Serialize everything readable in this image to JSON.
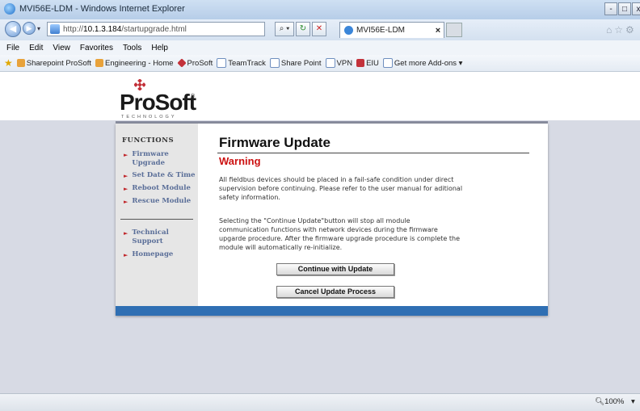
{
  "window": {
    "title": "MVI56E-LDM - Windows Internet Explorer",
    "buttons": [
      "-",
      "□",
      "x"
    ]
  },
  "address_bar": {
    "url_prefix": "http://",
    "url_host": "10.1.3.184",
    "url_path": "/startupgrade.html",
    "search_button": "⌕ ▾",
    "refresh_button": "↻",
    "stop_button": "✕"
  },
  "tab": {
    "title": "MVI56E-LDM",
    "close": "×"
  },
  "menu": [
    "File",
    "Edit",
    "View",
    "Favorites",
    "Tools",
    "Help"
  ],
  "favorites": [
    {
      "label": "Sharepoint ProSoft",
      "color": "#e8a23a"
    },
    {
      "label": "Engineering - Home",
      "color": "#e8a23a"
    },
    {
      "label": "ProSoft",
      "color": "#c3323a"
    },
    {
      "label": "TeamTrack",
      "color": "#6f8fbf"
    },
    {
      "label": "Share Point",
      "color": "#6f8fbf"
    },
    {
      "label": "VPN",
      "color": "#6f8fbf"
    },
    {
      "label": "EIU",
      "color": "#c3323a"
    },
    {
      "label": "Get more Add-ons ▾",
      "color": "#6f8fbf"
    }
  ],
  "logo": {
    "word": "ProSoft",
    "registered": "®",
    "sub": "TECHNOLOGY"
  },
  "sidebar": {
    "title": "FUNCTIONS",
    "items": [
      {
        "label": "Firmware Upgrade"
      },
      {
        "label": "Set Date & Time"
      },
      {
        "label": "Reboot Module"
      },
      {
        "label": "Rescue Module"
      }
    ],
    "items2": [
      {
        "label": "Technical Support"
      },
      {
        "label": "Homepage"
      }
    ]
  },
  "content": {
    "title": "Firmware Update",
    "warning": "Warning",
    "para1": "All fieldbus devices should be placed in a fail-safe condition under direct supervision before continuing. Please refer to the user manual for aditional safety information.",
    "para2": "Selecting the \"Continue Update\"button will stop all module communication functions with network devices during the firmware upgarde procedure. After the firmware upgrade procedure is complete the module will automatically re-initialize.",
    "continue_button": "Continue with Update",
    "cancel_button": "Cancel Update Process"
  },
  "status": {
    "zoom": "100%",
    "zoom_arrow": "▾"
  },
  "colors": {
    "warning": "#cc1111",
    "link": "#5a6e98",
    "footer": "#2f6fb3"
  }
}
